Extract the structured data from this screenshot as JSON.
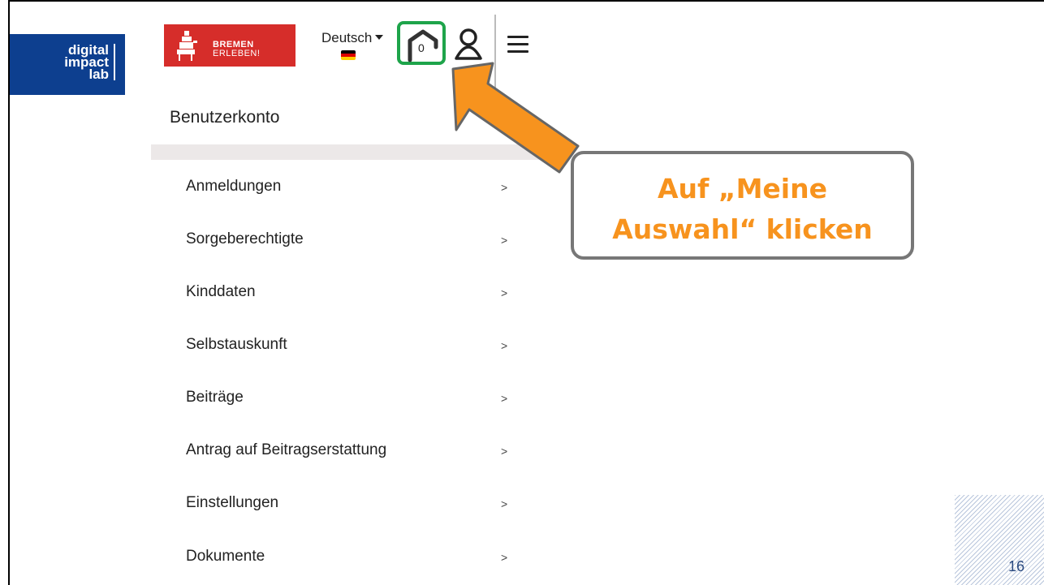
{
  "slide": {
    "page_number": "16",
    "logo_lines": [
      "digital",
      "impact",
      "lab"
    ]
  },
  "header": {
    "brand_line1": "BREMEN",
    "brand_line2": "ERLEBEN!",
    "language": "Deutsch",
    "selection_count": "0"
  },
  "account": {
    "title": "Benutzerkonto",
    "menu": [
      {
        "label": "Anmeldungen",
        "chevron": ">"
      },
      {
        "label": "Sorgeberechtigte",
        "chevron": ">"
      },
      {
        "label": "Kinddaten",
        "chevron": ">"
      },
      {
        "label": "Selbstauskunft",
        "chevron": ">"
      },
      {
        "label": "Beiträge",
        "chevron": ">"
      },
      {
        "label": "Antrag auf Beitragserstattung",
        "chevron": ">"
      },
      {
        "label": "Einstellungen",
        "chevron": ">"
      },
      {
        "label": "Dokumente",
        "chevron": ">"
      }
    ]
  },
  "callout": {
    "line1": "Auf „Meine",
    "line2": "Auswahl“ klicken"
  },
  "colors": {
    "highlight": "#1ea44a",
    "arrow": "#f7931e",
    "callout_text": "#f7931e",
    "logo_bg": "#0d3f8f",
    "brand_bg": "#d62d2a"
  }
}
